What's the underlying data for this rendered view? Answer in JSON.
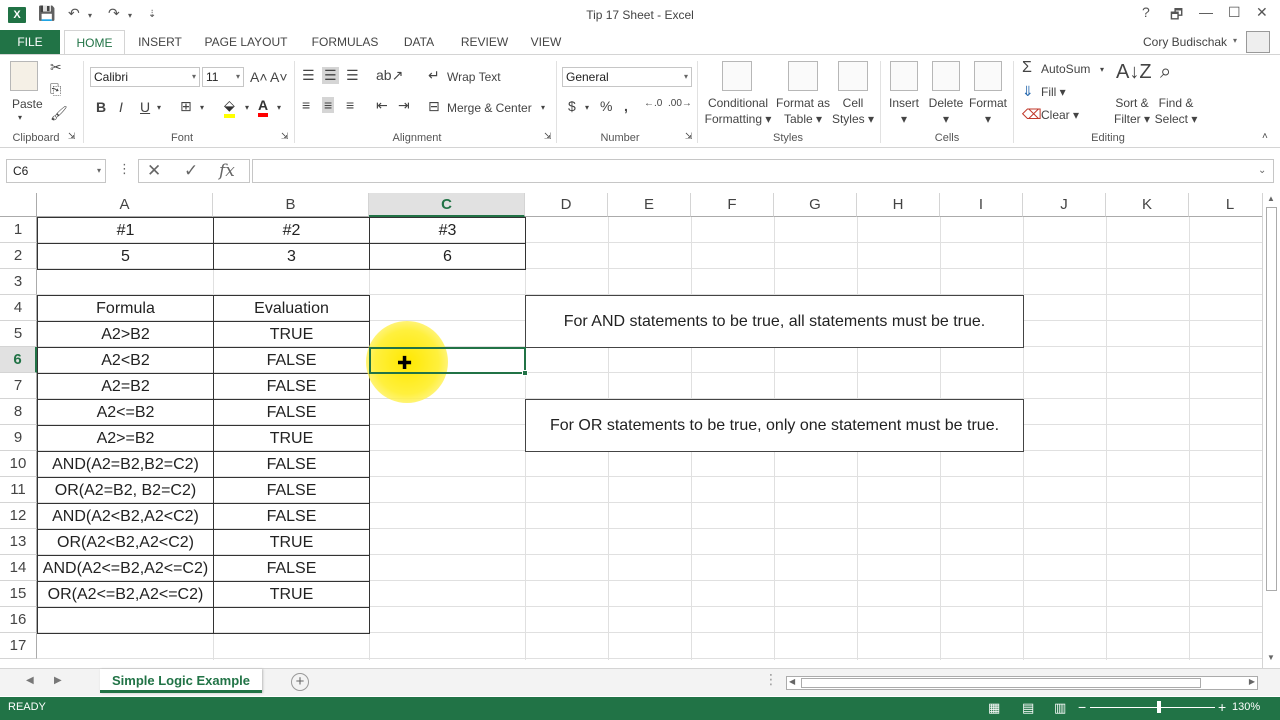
{
  "window": {
    "title": "Tip 17 Sheet - Excel",
    "app_icon": "X",
    "controls": [
      "?",
      "🗗",
      "—",
      "☐",
      "✕"
    ]
  },
  "ribbon_tabs": {
    "file": "FILE",
    "tabs": [
      "HOME",
      "INSERT",
      "PAGE LAYOUT",
      "FORMULAS",
      "DATA",
      "REVIEW",
      "VIEW"
    ],
    "active": "HOME",
    "user": "Cory Budischak"
  },
  "ribbon": {
    "clipboard": {
      "paste": "Paste",
      "label": "Clipboard"
    },
    "font": {
      "name": "Calibri",
      "size": "11",
      "label": "Font",
      "bold": "B",
      "italic": "I",
      "underline": "U"
    },
    "alignment": {
      "wrap": "Wrap Text",
      "merge": "Merge & Center",
      "label": "Alignment"
    },
    "number": {
      "format": "General",
      "label": "Number"
    },
    "styles": {
      "conditional": [
        "Conditional",
        "Formatting"
      ],
      "format_table": [
        "Format as",
        "Table"
      ],
      "cell_styles": [
        "Cell",
        "Styles"
      ],
      "label": "Styles"
    },
    "cells": {
      "insert": "Insert",
      "delete": "Delete",
      "format": "Format",
      "label": "Cells"
    },
    "editing": {
      "autosum": "AutoSum",
      "fill": "Fill",
      "clear": "Clear",
      "sort": [
        "Sort &",
        "Filter"
      ],
      "find": [
        "Find &",
        "Select"
      ],
      "label": "Editing"
    }
  },
  "formula_bar": {
    "name_box": "C6",
    "formula": ""
  },
  "grid": {
    "columns": [
      "A",
      "B",
      "C",
      "D",
      "E",
      "F",
      "G",
      "H",
      "I",
      "J",
      "K",
      "L"
    ],
    "selected_column": "C",
    "rows": [
      "1",
      "2",
      "3",
      "4",
      "5",
      "6",
      "7",
      "8",
      "9",
      "10",
      "11",
      "12",
      "13",
      "14",
      "15",
      "16",
      "17"
    ],
    "selected_row": "6",
    "header_row": [
      "#1",
      "#2",
      "#3"
    ],
    "value_row": [
      "5",
      "3",
      "6"
    ],
    "table_headers": [
      "Formula",
      "Evaluation"
    ],
    "table_rows": [
      [
        "A2>B2",
        "TRUE"
      ],
      [
        "A2<B2",
        "FALSE"
      ],
      [
        "A2=B2",
        "FALSE"
      ],
      [
        "A2<=B2",
        "FALSE"
      ],
      [
        "A2>=B2",
        "TRUE"
      ],
      [
        "AND(A2=B2,B2=C2)",
        "FALSE"
      ],
      [
        "OR(A2=B2, B2=C2)",
        "FALSE"
      ],
      [
        "AND(A2<B2,A2<C2)",
        "FALSE"
      ],
      [
        "OR(A2<B2,A2<C2)",
        "TRUE"
      ],
      [
        "AND(A2<=B2,A2<=C2)",
        "FALSE"
      ],
      [
        "OR(A2<=B2,A2<=C2)",
        "TRUE"
      ]
    ],
    "notes": [
      "For AND statements to be true, all statements must be true.",
      "For OR statements to be true, only one statement must be true."
    ]
  },
  "sheet_tabs": {
    "active": "Simple Logic Example",
    "add": "+"
  },
  "status": {
    "ready": "READY",
    "zoom": "130%"
  }
}
